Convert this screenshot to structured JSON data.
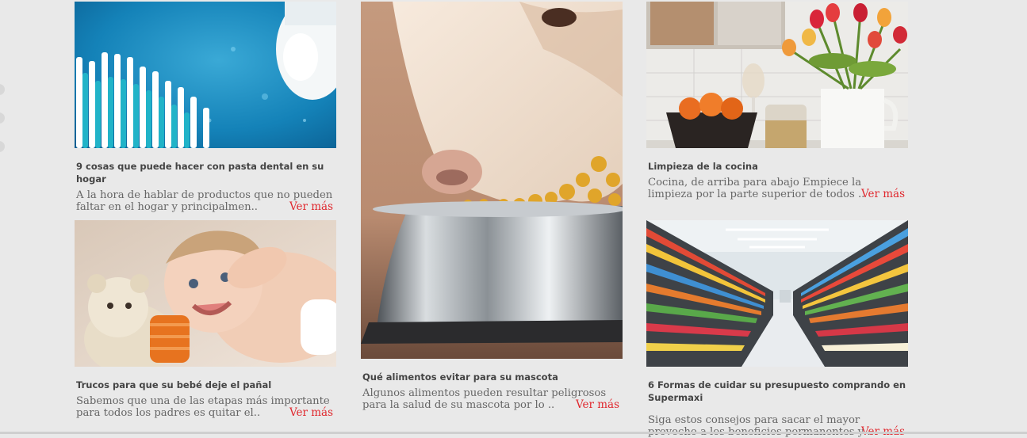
{
  "articles": [
    {
      "title": "9 cosas que puede hacer con pasta dental en su hogar",
      "excerpt": "A la hora de hablar de productos que no pueden faltar en el hogar y principalmen..",
      "more": "Ver más",
      "image": "toothbrush-toothpaste-photo"
    },
    {
      "title": "Trucos para que su bebé deje el pañal",
      "excerpt": "Sabemos que una de las etapas más importante para todos los padres es quitar el..",
      "more": "Ver más",
      "image": "baby-with-teddy-photo"
    },
    {
      "title": "Qué alimentos evitar para su mascota",
      "excerpt": "Algunos alimentos pueden resultar peligrosos para la salud de su mascota por lo ..",
      "more": "Ver más",
      "image": "dog-eating-kibble-photo"
    },
    {
      "title": "Limpieza de la cocina",
      "excerpt": "Cocina, de arriba para abajo Empiece la limpieza por la parte superior de todos ..",
      "more": "Ver más",
      "image": "kitchen-tulips-photo"
    },
    {
      "title": "6 Formas de cuidar su presupuesto comprando en Supermaxi",
      "excerpt": "Siga estos consejos para sacar el mayor provecho a los beneficios permanentes y ..",
      "more": "Ver más",
      "image": "supermarket-aisle-photo"
    }
  ],
  "colors": {
    "background": "#e9e9e9",
    "title": "#444444",
    "excerpt": "#666666",
    "link": "#e0282e"
  }
}
